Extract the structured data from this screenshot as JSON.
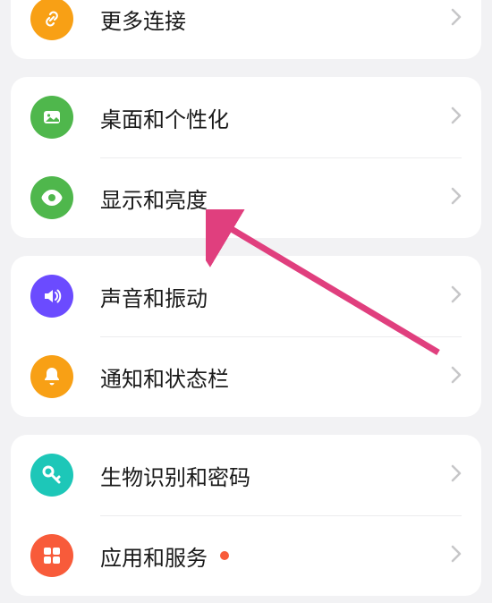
{
  "colors": {
    "orange": "#f8a015",
    "green": "#4fb74c",
    "purple": "#6b4bff",
    "red": "#f85b3a",
    "teal": "#1dc7b8",
    "arrow": "#e03f7e"
  },
  "groups": [
    {
      "items": [
        {
          "icon": "link-icon",
          "label": "更多连接",
          "color": "orange",
          "dot": false
        }
      ]
    },
    {
      "items": [
        {
          "icon": "image-icon",
          "label": "桌面和个性化",
          "color": "green",
          "dot": false
        },
        {
          "icon": "eye-icon",
          "label": "显示和亮度",
          "color": "green",
          "dot": false
        }
      ]
    },
    {
      "items": [
        {
          "icon": "volume-icon",
          "label": "声音和振动",
          "color": "purple",
          "dot": false
        },
        {
          "icon": "bell-icon",
          "label": "通知和状态栏",
          "color": "orange",
          "dot": false
        }
      ]
    },
    {
      "items": [
        {
          "icon": "key-icon",
          "label": "生物识别和密码",
          "color": "teal",
          "dot": false
        },
        {
          "icon": "grid-icon",
          "label": "应用和服务",
          "color": "red",
          "dot": true
        }
      ]
    }
  ]
}
